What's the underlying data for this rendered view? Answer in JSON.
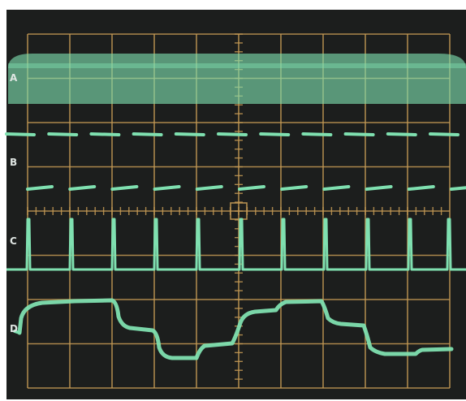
{
  "traces": [
    {
      "label": "A"
    },
    {
      "label": "B"
    },
    {
      "label": "C"
    },
    {
      "label": "D"
    }
  ],
  "colors": {
    "screen_background": "#1c1e1d",
    "graticule": "#c49a55",
    "trace": "#7fe0b0",
    "trace_dim": "#4fbf8c",
    "label": "#dfe5e2"
  }
}
